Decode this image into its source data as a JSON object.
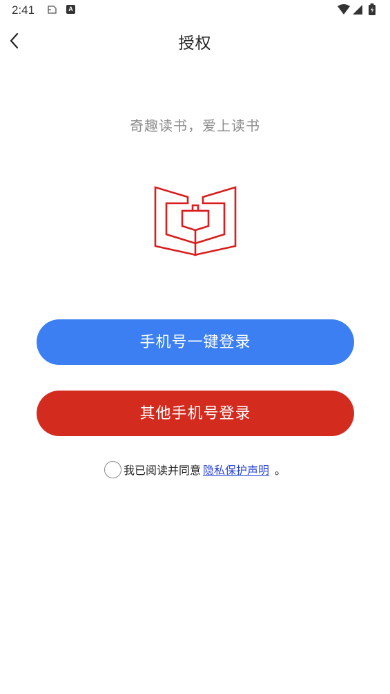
{
  "status_bar": {
    "time": "2:41",
    "icons": [
      "notification-icon",
      "keyboard-a-icon",
      "wifi-icon",
      "signal-icon",
      "battery-icon"
    ]
  },
  "header": {
    "title": "授权",
    "back_icon": "chevron-left-icon"
  },
  "slogan": "奇趣读书，爱上读书",
  "logo": {
    "icon": "open-book-logo-icon",
    "color": "#d81e1e"
  },
  "buttons": {
    "one_click_login": "手机号一键登录",
    "other_phone_login": "其他手机号登录"
  },
  "agreement": {
    "text": "我已阅读并同意",
    "link": "隐私保护声明",
    "period": "。",
    "checked": false
  },
  "colors": {
    "primary_blue": "#3b7ff2",
    "primary_red": "#d42b1f",
    "link_blue": "#2b47d8"
  }
}
